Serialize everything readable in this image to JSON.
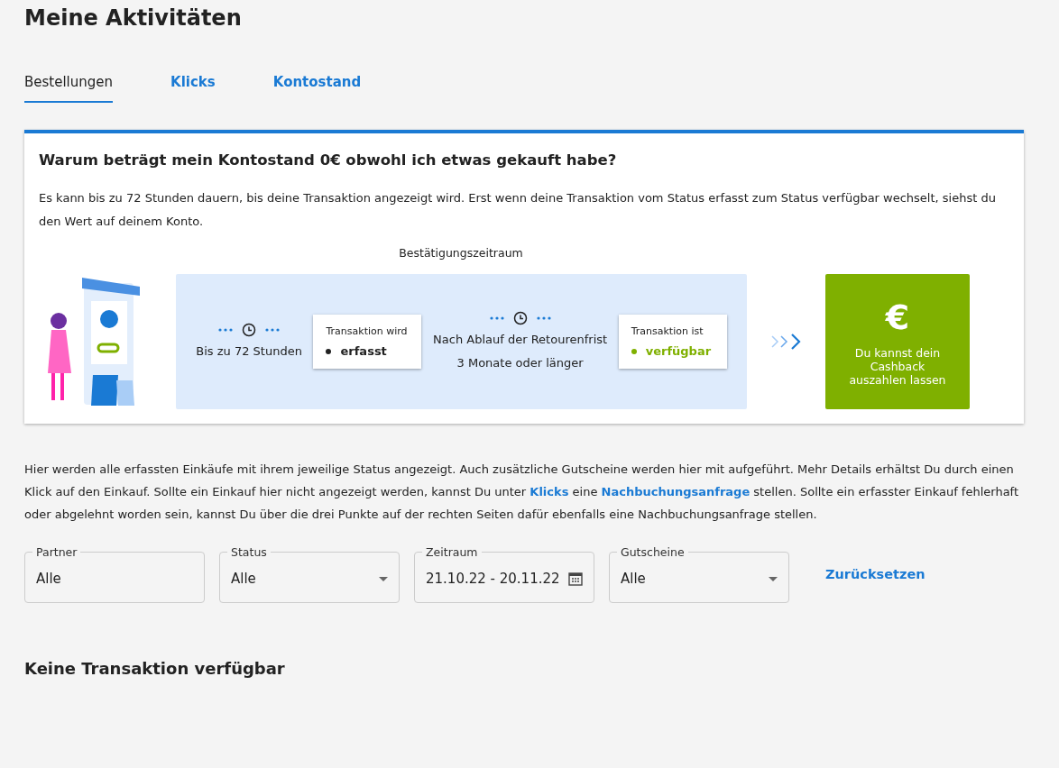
{
  "page_title": "Meine Aktivitäten",
  "tabs": [
    {
      "label": "Bestellungen",
      "selected": true
    },
    {
      "label": "Klicks",
      "selected": false
    },
    {
      "label": "Kontostand",
      "selected": false
    }
  ],
  "info_card": {
    "title": "Warum beträgt mein Kontostand 0€ obwohl ich etwas gekauft habe?",
    "text": "Es kann bis zu 72 Stunden dauern, bis deine Transaktion angezeigt wird. Erst wenn deine Transaktion vom Status erfasst zum Status verfügbar wechselt, siehst du den Wert auf deinem Konto.",
    "period_label": "Bestätigungszeitraum",
    "steps": [
      {
        "kind": "duration",
        "lines": [
          "Bis zu 72 Stunden"
        ]
      },
      {
        "kind": "status",
        "caption": "Transaktion wird",
        "status": "erfasst",
        "available": false
      },
      {
        "kind": "duration",
        "lines": [
          "Nach Ablauf der Retourenfrist",
          "3 Monate oder länger"
        ]
      },
      {
        "kind": "status",
        "caption": "Transaktion ist",
        "status": "verfügbar",
        "available": true
      }
    ],
    "payout": {
      "symbol": "€",
      "text": "Du kannst dein Cashback auszahlen lassen"
    }
  },
  "description": [
    {
      "kind": "text",
      "text": "Hier werden alle erfassten Einkäufe mit ihrem jeweilige Status angezeigt. Auch zusätzliche Gutscheine werden hier mit aufgeführt. Mehr Details erhältst Du durch einen Klick auf den Einkauf. Sollte ein Einkauf hier nicht angezeigt werden, kannst Du unter "
    },
    {
      "kind": "link",
      "text": "Klicks"
    },
    {
      "kind": "text",
      "text": " eine "
    },
    {
      "kind": "link",
      "text": "Nachbuchungsanfrage"
    },
    {
      "kind": "text",
      "text": " stellen. Sollte ein erfasster Einkauf fehlerhaft oder abgelehnt worden sein, kannst Du über die drei Punkte auf der rechten Seiten dafür ebenfalls eine Nachbuchungsanfrage stellen."
    }
  ],
  "filters": [
    {
      "kind": "text",
      "label": "Partner",
      "value": "Alle"
    },
    {
      "kind": "select",
      "label": "Status",
      "value": "Alle"
    },
    {
      "kind": "date",
      "label": "Zeitraum",
      "value": "21.10.22 - 20.11.22"
    },
    {
      "kind": "select",
      "label": "Gutscheine",
      "value": "Alle"
    }
  ],
  "reset_label": "Zurücksetzen",
  "empty_message": "Keine Transaktion verfügbar"
}
